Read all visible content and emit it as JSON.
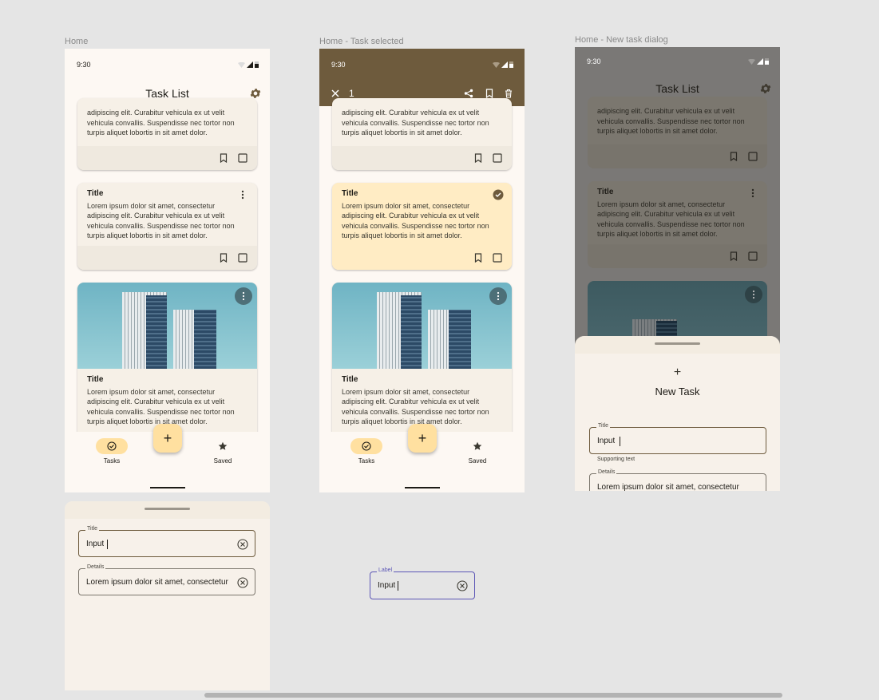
{
  "frames": {
    "home": "Home",
    "selected": "Home - Task selected",
    "dialog": "Home - New task dialog"
  },
  "status": {
    "time": "9:30"
  },
  "app": {
    "title": "Task List"
  },
  "lorem": "Lorem ipsum dolor sit amet, consectetur adipiscing elit. Curabitur vehicula ex ut velit vehicula convallis. Suspendisse nec tortor non turpis aliquet lobortis in sit amet dolor.",
  "lorem_partial": "adipiscing elit. Curabitur vehicula ex ut velit vehicula convallis. Suspendisse nec tortor non turpis aliquet lobortis in sit amet dolor.",
  "card_title": "Title",
  "nav": {
    "tasks": "Tasks",
    "saved": "Saved",
    "fab": "+"
  },
  "selection": {
    "count": "1"
  },
  "new_task": {
    "icon": "+",
    "heading": "New Task",
    "title_label": "Title",
    "title_value": "Input",
    "supporting": "Supporting text",
    "details_label": "Details",
    "details_value": "Lorem ipsum dolor sit amet, consectetur"
  },
  "sheet": {
    "title_label": "Title",
    "title_value": "Input",
    "details_label": "Details",
    "details_value": "Lorem ipsum dolor sit amet, consectetur"
  },
  "standalone_field": {
    "label": "Label",
    "value": "Input"
  },
  "colors": {
    "surface": "#fdf8f3",
    "card": "#f6f0e7",
    "selected_card": "#ffecc4",
    "action_bar": "#6e5b3d",
    "fab": "#ffe0a0",
    "focus": "#5b55b5"
  }
}
